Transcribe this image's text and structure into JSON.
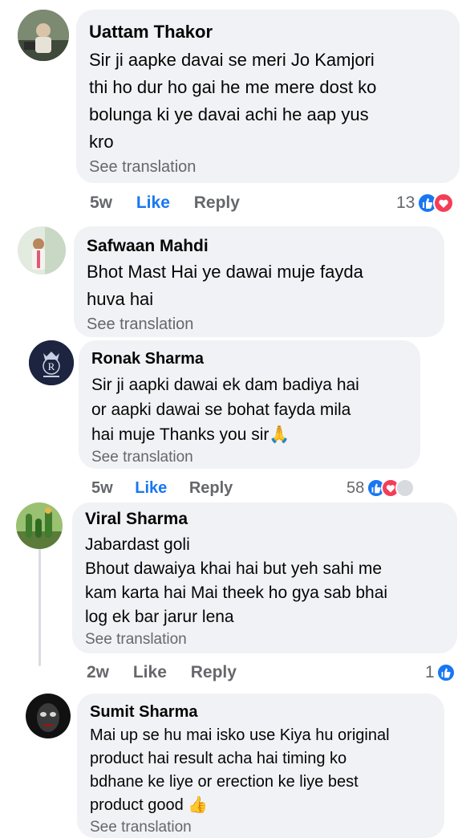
{
  "comments": [
    {
      "name": "Uattam Thakor",
      "lines": [
        "Sir ji aapke davai se meri Jo Kamjori",
        "thi ho dur ho gai he me mere dost ko",
        "bolunga ki ye davai achi he aap yus",
        "kro"
      ],
      "see_translation": "See translation",
      "time": "5w",
      "like": "Like",
      "reply": "Reply",
      "reaction_count": "13",
      "reaction_icons": [
        "like-reaction-icon",
        "love-reaction-icon"
      ]
    },
    {
      "name": "Safwaan Mahdi",
      "lines": [
        "Bhot Mast Hai ye dawai muje fayda",
        "huva hai"
      ],
      "see_translation": "See translation"
    },
    {
      "name": "Ronak Sharma",
      "avatar_letter": "R",
      "lines": [
        "Sir ji aapki dawai ek dam badiya hai",
        "or aapki dawai se bohat fayda mila",
        "hai muje Thanks you sir🙏"
      ],
      "see_translation": "See translation",
      "time": "5w",
      "like": "Like",
      "reply": "Reply",
      "reaction_count": "58",
      "reaction_icons": [
        "like-reaction-icon",
        "love-reaction-icon",
        "care-reaction-icon"
      ]
    },
    {
      "name": "Viral Sharma",
      "lines": [
        "Jabardast goli",
        "Bhout dawaiya khai hai but yeh sahi me",
        "kam karta hai Mai theek ho gya sab bhai",
        "log ek bar jarur lena"
      ],
      "see_translation": "See translation",
      "time": "2w",
      "like": "Like",
      "reply": "Reply",
      "reaction_count": "1",
      "reaction_icons": [
        "like-reaction-icon"
      ]
    },
    {
      "name": "Sumit Sharma",
      "lines": [
        "Mai up se hu mai isko use Kiya hu original",
        "product hai result acha hai timing ko",
        "bdhane ke liye or erection ke liye best",
        "product good 👍"
      ],
      "see_translation": "See translation"
    }
  ],
  "colors": {
    "bubble": "#f0f2f5",
    "like_active": "#1877f2",
    "meta": "#65676b",
    "love": "#f33e58"
  }
}
